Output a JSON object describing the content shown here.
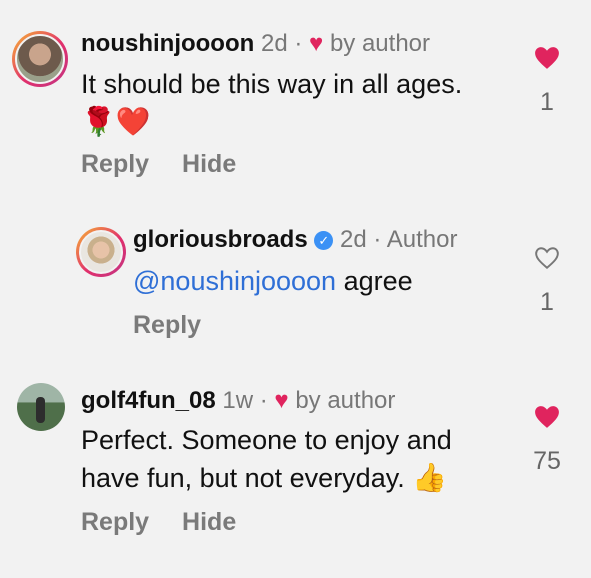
{
  "comments": [
    {
      "username": "noushinjoooon",
      "time": "2d",
      "sep": "·",
      "liked_marker": "♥",
      "liked_text": "by author",
      "text": "It should be this way in all ages.",
      "emoji": "🌹❤️",
      "reply_label": "Reply",
      "hide_label": "Hide",
      "like_count": "1",
      "liked": true
    },
    {
      "username": "gloriousbroads",
      "verified": true,
      "time": "2d",
      "sep": "·",
      "role": "Author",
      "mention": "@noushinjoooon",
      "text": " agree",
      "reply_label": "Reply",
      "like_count": "1",
      "liked": false
    },
    {
      "username": "golf4fun_08",
      "time": "1w",
      "sep": "·",
      "liked_marker": "♥",
      "liked_text": "by author",
      "text_line1": "Perfect. Someone to enjoy and",
      "text_line2": "have fun, but not everyday.",
      "emoji": "👍",
      "reply_label": "Reply",
      "hide_label": "Hide",
      "like_count": "75",
      "liked": true
    }
  ],
  "colors": {
    "heart": "#e0245e",
    "mention": "#2f6fd6",
    "verified": "#3b91f5"
  }
}
